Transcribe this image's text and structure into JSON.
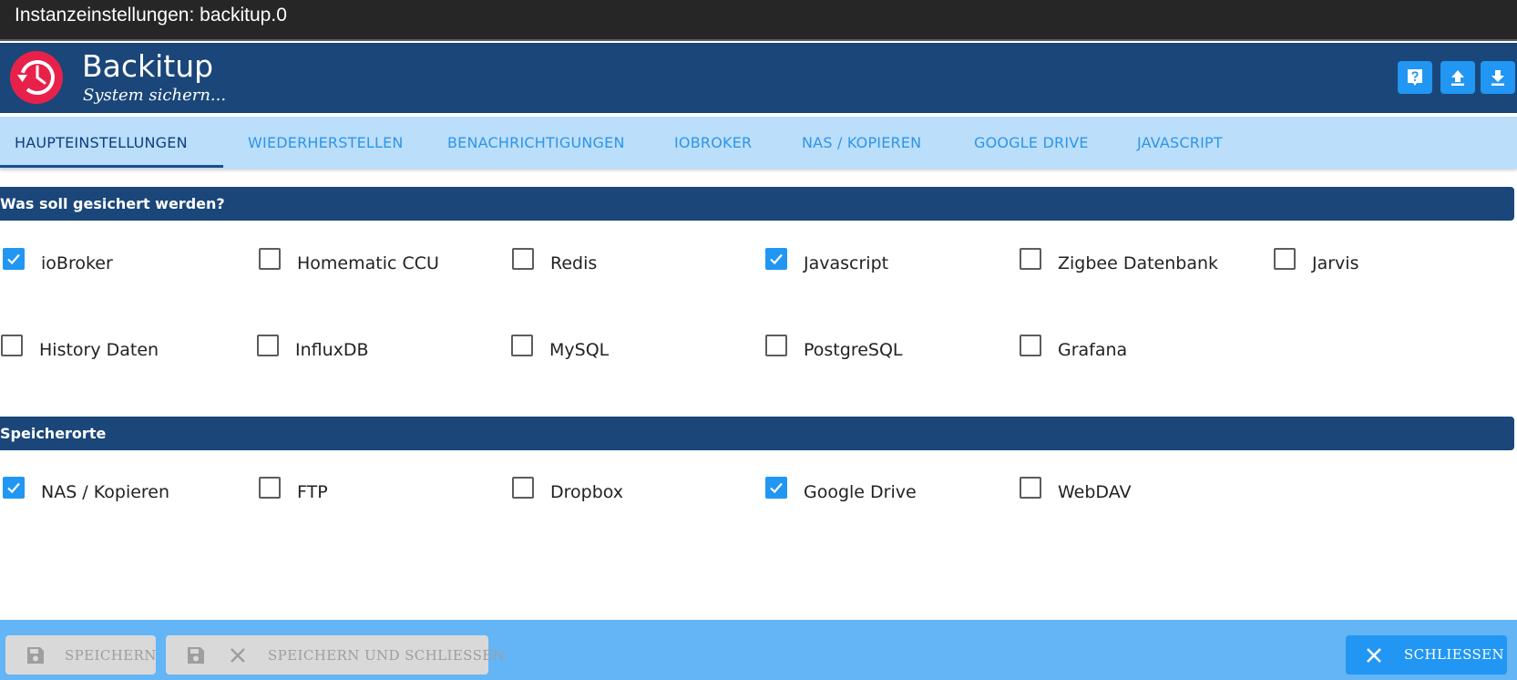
{
  "window": {
    "title": "Instanzeinstellungen: backitup.0"
  },
  "header": {
    "title": "Backitup",
    "subtitle": "System sichern...",
    "buttons": [
      {
        "icon": "help-icon"
      },
      {
        "icon": "upload-icon"
      },
      {
        "icon": "download-icon"
      }
    ],
    "colors": {
      "bar": "#1a4679",
      "logo": "#e8214b",
      "button": "#2196f3"
    }
  },
  "tabs": [
    {
      "label": "HAUPTEINSTELLUNGEN",
      "active": true
    },
    {
      "label": "WIEDERHERSTELLEN",
      "active": false
    },
    {
      "label": "BENACHRICHTIGUNGEN",
      "active": false
    },
    {
      "label": "IOBROKER",
      "active": false
    },
    {
      "label": "NAS / KOPIEREN",
      "active": false
    },
    {
      "label": "GOOGLE DRIVE",
      "active": false
    },
    {
      "label": "JAVASCRIPT",
      "active": false
    }
  ],
  "sections": {
    "backup": {
      "title": "Was soll gesichert werden?",
      "options": [
        {
          "label": "ioBroker",
          "checked": true
        },
        {
          "label": "Homematic CCU",
          "checked": false
        },
        {
          "label": "Redis",
          "checked": false
        },
        {
          "label": "Javascript",
          "checked": true
        },
        {
          "label": "Zigbee Datenbank",
          "checked": false
        },
        {
          "label": "Jarvis",
          "checked": false
        },
        {
          "label": "History Daten",
          "checked": false
        },
        {
          "label": "InfluxDB",
          "checked": false
        },
        {
          "label": "MySQL",
          "checked": false
        },
        {
          "label": "PostgreSQL",
          "checked": false
        },
        {
          "label": "Grafana",
          "checked": false
        }
      ]
    },
    "storage": {
      "title": "Speicherorte",
      "options": [
        {
          "label": "NAS / Kopieren",
          "checked": true
        },
        {
          "label": "FTP",
          "checked": false
        },
        {
          "label": "Dropbox",
          "checked": false
        },
        {
          "label": "Google Drive",
          "checked": true
        },
        {
          "label": "WebDAV",
          "checked": false
        }
      ]
    }
  },
  "footer": {
    "save_label": "SPEICHERN",
    "save_close_label": "SPEICHERN UND SCHLIESSEN",
    "close_label": "SCHLIESSEN"
  }
}
